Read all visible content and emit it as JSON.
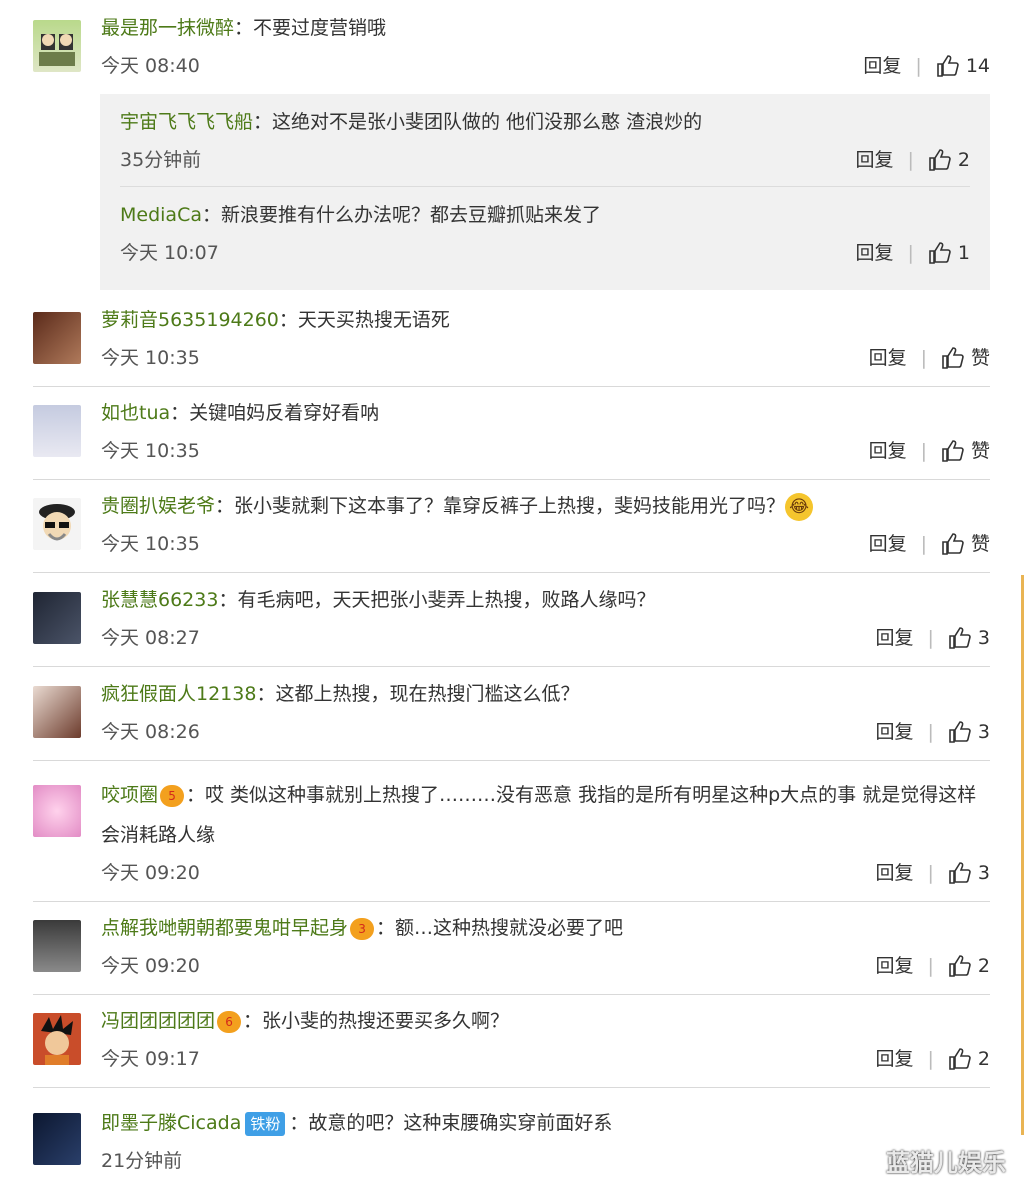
{
  "comments": [
    {
      "name": "最是那一抹微醉",
      "text": "：不要过度营销哦",
      "time": "今天 08:40",
      "reply": "回复",
      "likes": "14"
    },
    {
      "name": "萝莉音5635194260",
      "text": "：天天买热搜无语死",
      "time": "今天 10:35",
      "reply": "回复",
      "likes": "赞"
    },
    {
      "name": "如也tua",
      "text": "：关键咱妈反着穿好看呐",
      "time": "今天 10:35",
      "reply": "回复",
      "likes": "赞"
    },
    {
      "name": "贵圈扒娱老爷",
      "text": "：张小斐就剩下这本事了？靠穿反裤子上热搜，斐妈技能用光了吗？",
      "time": "今天 10:35",
      "reply": "回复",
      "likes": "赞"
    },
    {
      "name": "张慧慧66233",
      "text": "：有毛病吧，天天把张小斐弄上热搜，败路人缘吗？",
      "time": "今天 08:27",
      "reply": "回复",
      "likes": "3"
    },
    {
      "name": "疯狂假面人12138",
      "text": "：这都上热搜，现在热搜门槛这么低？",
      "time": "今天 08:26",
      "reply": "回复",
      "likes": "3"
    },
    {
      "name": "咬项圈",
      "text": "：哎 类似这种事就别上热搜了………没有恶意 我指的是所有明星这种p大点的事  就是觉得这样会消耗路人缘",
      "time": "今天 09:20",
      "reply": "回复",
      "likes": "3"
    },
    {
      "name": "点解我哋朝朝都要鬼咁早起身",
      "text": "：额…这种热搜就没必要了吧",
      "time": "今天 09:20",
      "reply": "回复",
      "likes": "2"
    },
    {
      "name": "冯团团团团团",
      "text": "：张小斐的热搜还要买多久啊？",
      "time": "今天 09:17",
      "reply": "回复",
      "likes": "2"
    },
    {
      "name": "即墨子滕Cicada",
      "badge": "铁粉",
      "text": "：故意的吧？这种束腰确实穿前面好系",
      "time": "21分钟前"
    }
  ],
  "replies": [
    {
      "name": "宇宙飞飞飞飞船",
      "text": "：这绝对不是张小斐团队做的  他们没那么憨  渣浪炒的",
      "time": "35分钟前",
      "reply": "回复",
      "likes": "2"
    },
    {
      "name": "MediaCa",
      "text": "：新浪要推有什么办法呢？都去豆瓣抓贴来发了",
      "time": "今天 10:07",
      "reply": "回复",
      "likes": "1"
    }
  ],
  "vip_badge": "5",
  "vip_badge_3": "3",
  "vip_badge_6": "6",
  "emoji": "😂",
  "watermark": "蓝猫儿娱乐",
  "colors": {
    "name": "#4d7a18",
    "reply_bg": "#f1f1f1",
    "fan_badge": "#3f9fe6"
  }
}
